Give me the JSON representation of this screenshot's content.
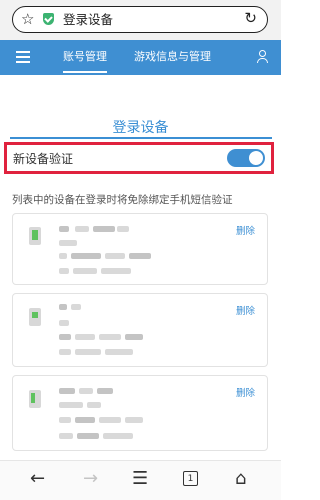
{
  "browser": {
    "url_title": "登录设备",
    "star_icon": "☆",
    "reload_icon": "↻"
  },
  "nav": {
    "tabs": [
      {
        "label": "账号管理",
        "active": true
      },
      {
        "label": "游戏信息与管理",
        "active": false
      }
    ],
    "accent_color": "#3f8fd2"
  },
  "page": {
    "title": "登录设备",
    "verify_label": "新设备验证",
    "verify_enabled": true,
    "description": "列表中的设备在登录时将免除绑定手机短信验证"
  },
  "devices": [
    {
      "delete_label": "删除"
    },
    {
      "delete_label": "删除"
    },
    {
      "delete_label": "删除"
    }
  ],
  "bottom_bar": {
    "back_icon": "←",
    "forward_icon": "→",
    "menu_icon": "☰",
    "tabs_count": "1",
    "home_icon": "⌂"
  }
}
